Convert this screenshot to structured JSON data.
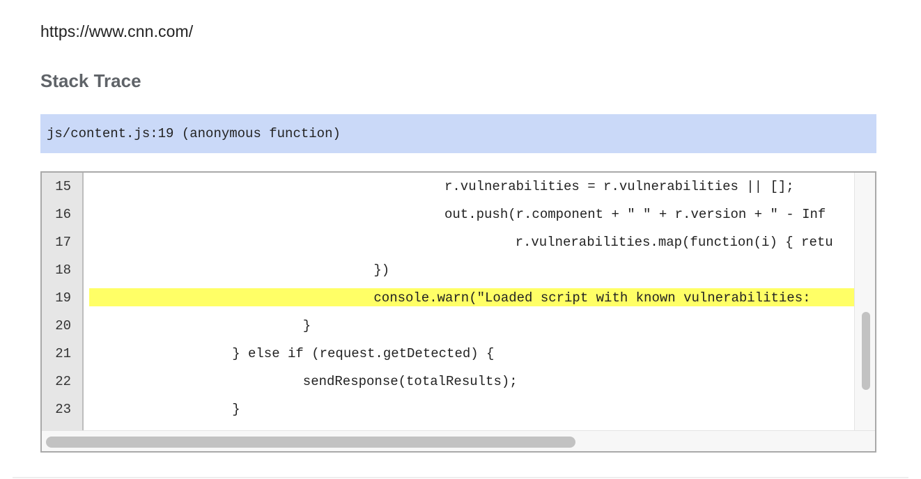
{
  "page": {
    "url": "https://www.cnn.com/",
    "section_title": "Stack Trace"
  },
  "stack_frame": {
    "label": "js/content.js:19 (anonymous function)"
  },
  "code_view": {
    "highlighted_line": 19,
    "highlight_color": "#ffff66",
    "lines": [
      {
        "num": "15",
        "text": "\t\t\t\t\tr.vulnerabilities = r.vulnerabilities || [];"
      },
      {
        "num": "16",
        "text": "\t\t\t\t\tout.push(r.component + \" \" + r.version + \" - Inf"
      },
      {
        "num": "17",
        "text": "\t\t\t\t\t\tr.vulnerabilities.map(function(i) { retu"
      },
      {
        "num": "18",
        "text": "\t\t\t\t})"
      },
      {
        "num": "19",
        "text": "\t\t\t\tconsole.warn(\"Loaded script with known vulnerabilities:"
      },
      {
        "num": "20",
        "text": "\t\t\t}"
      },
      {
        "num": "21",
        "text": "\t\t} else if (request.getDetected) {"
      },
      {
        "num": "22",
        "text": "\t\t\tsendResponse(totalResults);"
      },
      {
        "num": "23",
        "text": "\t\t}"
      }
    ]
  },
  "colors": {
    "frame_bar_bg": "#cad9f8",
    "heading_color": "#5f6368"
  }
}
